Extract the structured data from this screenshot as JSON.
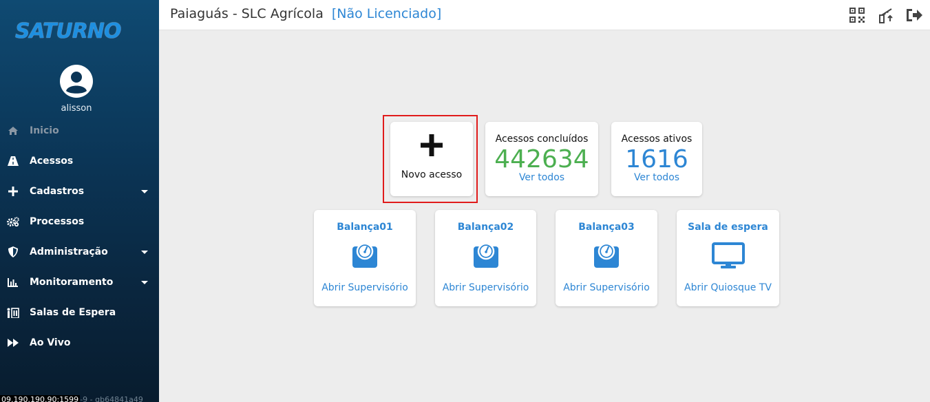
{
  "sidebar": {
    "logo_text": "SATURNO",
    "username": "alisson",
    "items": [
      {
        "label": "Inicio",
        "icon": "home-icon"
      },
      {
        "label": "Acessos",
        "icon": "road-icon"
      },
      {
        "label": "Cadastros",
        "icon": "plus-icon"
      },
      {
        "label": "Processos",
        "icon": "cogs-icon"
      },
      {
        "label": "Administração",
        "icon": "shield-icon"
      },
      {
        "label": "Monitoramento",
        "icon": "chart-bar-icon"
      },
      {
        "label": "Salas de Espera",
        "icon": "people-icon"
      },
      {
        "label": "Ao Vivo",
        "icon": "fast-forward-icon"
      }
    ],
    "version_ip": "09.190.190.90:1599",
    "version_hash": "-9 - gb64841a49"
  },
  "header": {
    "title": "Paiaguás - SLC Agrícola",
    "license": "[Não Licenciado]",
    "icons": [
      "qr-code-icon",
      "barrier-icon",
      "logout-icon"
    ]
  },
  "cards": {
    "novo": {
      "label": "Novo acesso",
      "icon": "plus-icon"
    },
    "concluidos": {
      "title": "Acessos concluídos",
      "value": "442634",
      "link": "Ver todos",
      "color": "#4caf50"
    },
    "ativos": {
      "title": "Acessos ativos",
      "value": "1616",
      "link": "Ver todos",
      "color": "#2d86d4"
    },
    "stations": [
      {
        "title": "Balança01",
        "link": "Abrir Supervisório",
        "icon": "scale-icon"
      },
      {
        "title": "Balança02",
        "link": "Abrir Supervisório",
        "icon": "scale-icon"
      },
      {
        "title": "Balança03",
        "link": "Abrir Supervisório",
        "icon": "scale-icon"
      },
      {
        "title": "Sala de espera",
        "link": "Abrir Quiosque TV",
        "icon": "monitor-icon"
      }
    ]
  },
  "colors": {
    "accent": "#2d86d4",
    "success": "#4caf50",
    "highlight": "#e01b1b"
  }
}
